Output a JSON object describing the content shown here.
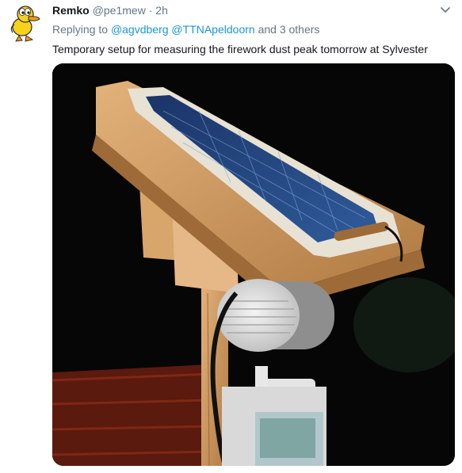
{
  "tweet": {
    "author": {
      "name": "Remko",
      "handle": "@pe1mew"
    },
    "separator": "·",
    "time": "2h",
    "replying": {
      "prefix": "Replying to",
      "mention1": "@agvdberg",
      "mention2": "@TTNApeldoorn",
      "suffix": "and 3 others"
    },
    "text": "Temporary setup for measuring the firework dust peak tomorrow at Sylvester"
  },
  "colors": {
    "link": "#1b95e0",
    "secondary": "#657786",
    "primary_text": "#14171a"
  },
  "icons": {
    "avatar": "yellow-duck-avatar",
    "menu": "chevron-down-icon"
  }
}
